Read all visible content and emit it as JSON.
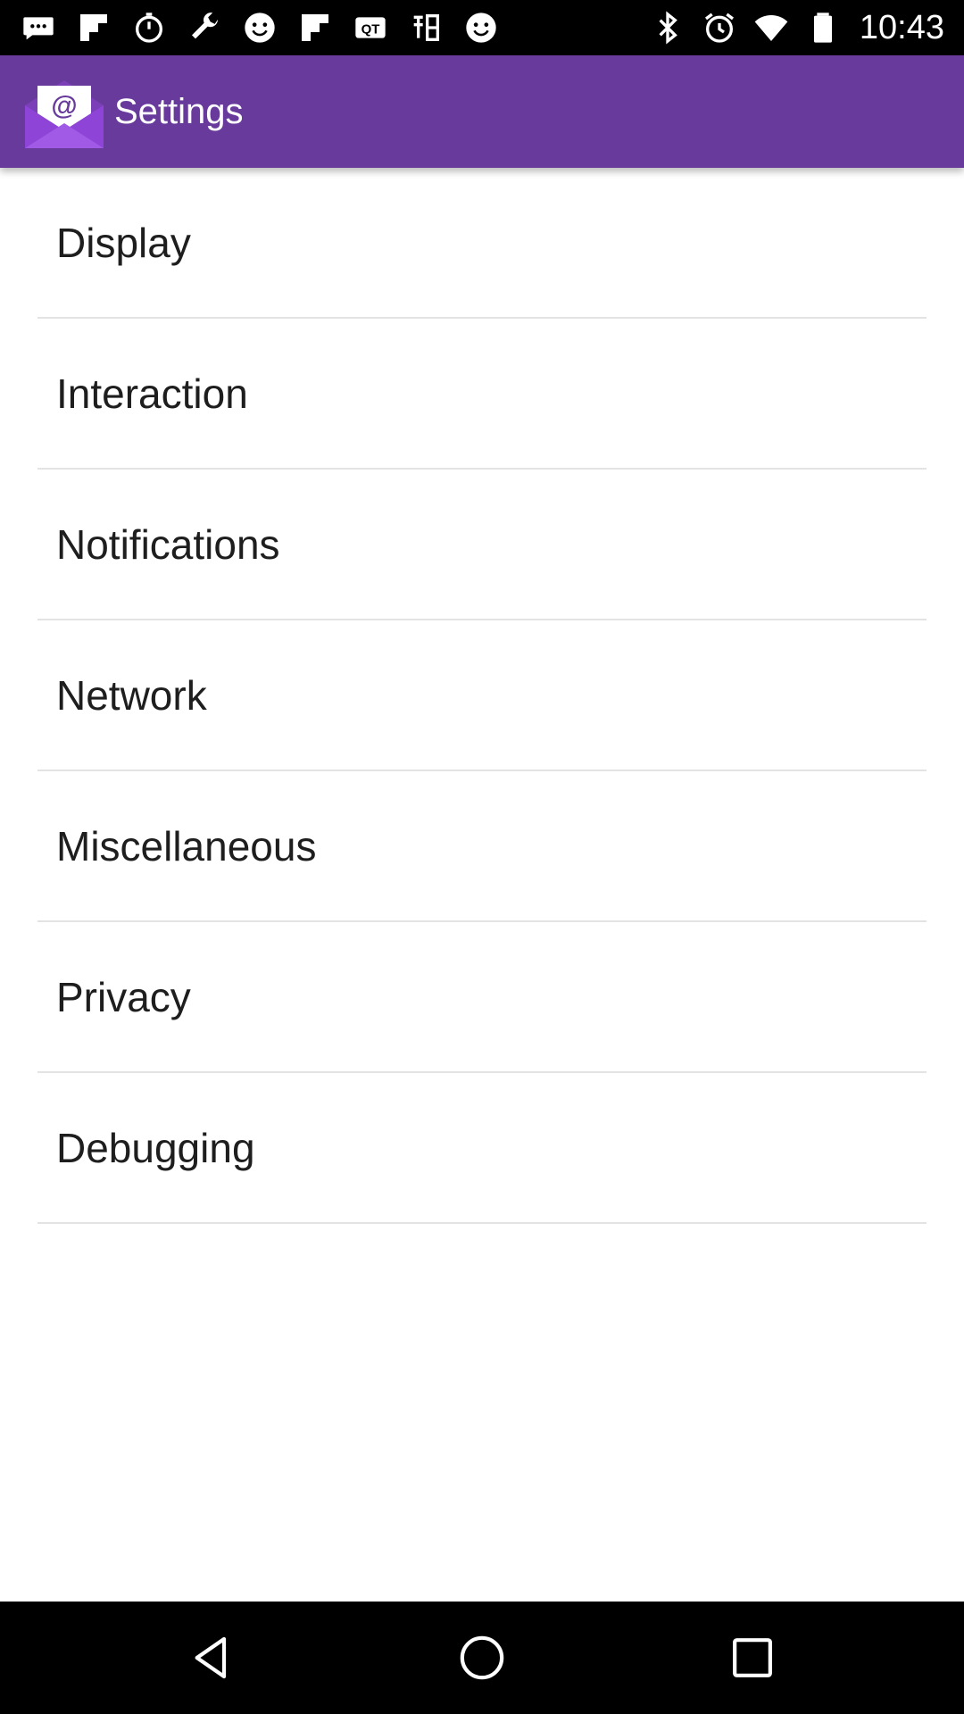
{
  "status_bar": {
    "time": "10:43",
    "left_icons": [
      "message-icon",
      "flipboard-icon",
      "stopwatch-icon",
      "wrench-icon",
      "smiley-icon",
      "flipboard-icon",
      "qt-icon",
      "chinese-char-icon",
      "smiley-icon"
    ],
    "right_icons": [
      "bluetooth-icon",
      "alarm-icon",
      "wifi-icon",
      "battery-icon"
    ]
  },
  "app_bar": {
    "title": "Settings",
    "icon": "email-envelope-icon",
    "color": "#673a9b"
  },
  "settings": {
    "items": [
      {
        "label": "Display"
      },
      {
        "label": "Interaction"
      },
      {
        "label": "Notifications"
      },
      {
        "label": "Network"
      },
      {
        "label": "Miscellaneous"
      },
      {
        "label": "Privacy"
      },
      {
        "label": "Debugging"
      }
    ]
  },
  "nav_bar": {
    "buttons": [
      "back-icon",
      "home-icon",
      "recents-icon"
    ]
  }
}
